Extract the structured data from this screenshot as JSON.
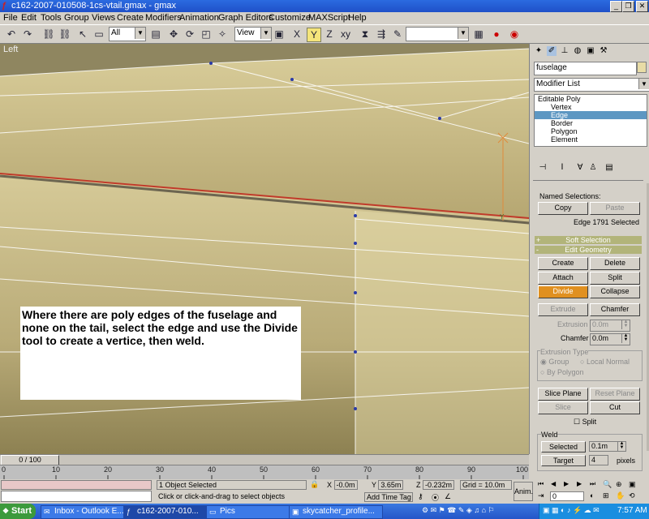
{
  "window": {
    "title": "c162-2007-010508-1cs-vtail.gmax - gmax"
  },
  "menu": [
    "File",
    "Edit",
    "Tools",
    "Group",
    "Views",
    "Create",
    "Modifiers",
    "Animation",
    "Graph Editors",
    "Customize",
    "MAXScript",
    "Help"
  ],
  "toolbar": {
    "selection_filter": "All",
    "ref_coord": "View",
    "named_sel": ""
  },
  "viewport": {
    "label": "Left",
    "note": "Where there are poly edges of the fuselage and none on the tail, select the edge and use the Divide tool to create a vertice, then weld."
  },
  "command_panel": {
    "object_name": "fuselage",
    "modifier_list": "Modifier List",
    "stack": {
      "root": "Editable Poly",
      "items": [
        "Vertex",
        "Edge",
        "Border",
        "Polygon",
        "Element"
      ],
      "selected": "Edge"
    },
    "named_selections_label": "Named Selections:",
    "copy": "Copy",
    "paste": "Paste",
    "selection_info": "Edge 1791 Selected",
    "soft_selection": "Soft Selection",
    "edit_geometry": "Edit Geometry",
    "create": "Create",
    "delete": "Delete",
    "attach": "Attach",
    "split": "Split",
    "divide": "Divide",
    "collapse": "Collapse",
    "extrude": "Extrude",
    "chamfer": "Chamfer",
    "extrusion_label": "Extrusion",
    "extrusion_value": "0.0m",
    "chamfer_label": "Chamfer",
    "chamfer_value": "0.0m",
    "extrusion_type_label": "Extrusion Type",
    "group_opt": "Group",
    "local_normal_opt": "Local Normal",
    "by_polygon_opt": "By Polygon",
    "slice_plane": "Slice Plane",
    "reset_plane": "Reset Plane",
    "slice": "Slice",
    "cut": "Cut",
    "split_check": "Split",
    "weld_label": "Weld",
    "weld_selected": "Selected",
    "weld_selected_value": "0.1m",
    "weld_target": "Target",
    "weld_target_value": "4",
    "pixels": "pixels"
  },
  "timeline": {
    "slider": "0 / 100",
    "ticks": [
      "0",
      "10",
      "20",
      "30",
      "40",
      "50",
      "60",
      "70",
      "80",
      "90",
      "100"
    ]
  },
  "status": {
    "objects_selected": "1 Object Selected",
    "prompt": "Click or click-and-drag to select objects",
    "x_label": "X",
    "x": "-0.0m",
    "y_label": "Y",
    "y": "3.65m",
    "z_label": "Z",
    "z": "-0.232m",
    "grid": "Grid = 10.0m",
    "add_time_tag": "Add Time Tag",
    "anim": "Anim.",
    "frame": "0"
  },
  "taskbar": {
    "start": "Start",
    "tasks": [
      "Inbox - Outlook E...",
      "c162-2007-010...",
      "Pics",
      "skycatcher_profile..."
    ],
    "clock": "7:57 AM"
  },
  "colors": {
    "titlebar": "#1f50c8",
    "fuselage": "#d2c592",
    "tail": "#e3d8a6",
    "accent": "#e09020",
    "rollout": "#b2b47a",
    "selected": "#5d97c2"
  }
}
